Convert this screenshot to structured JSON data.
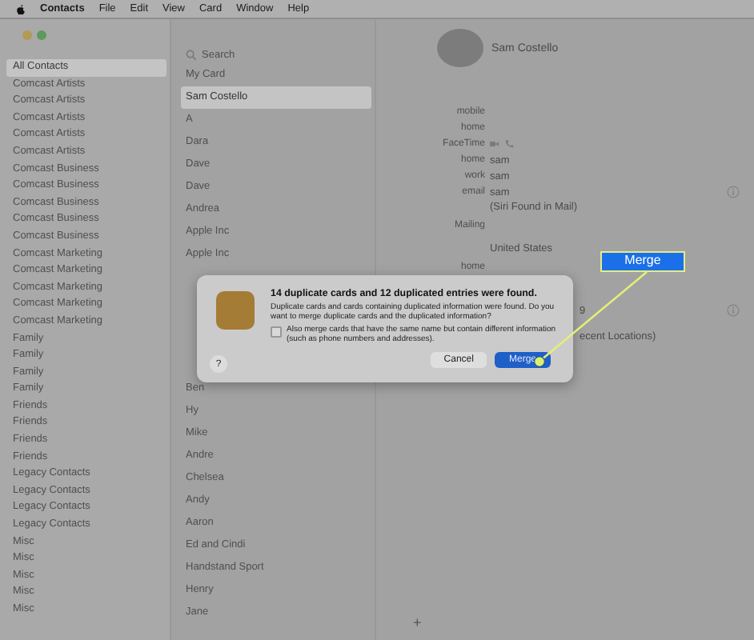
{
  "menu_bar": {
    "items": [
      {
        "label": "Contacts",
        "kind": "app"
      },
      {
        "label": "File",
        "kind": "menu"
      },
      {
        "label": "Edit",
        "kind": "menu"
      },
      {
        "label": "View",
        "kind": "menu"
      },
      {
        "label": "Card",
        "kind": "menu"
      },
      {
        "label": "Window",
        "kind": "menu"
      },
      {
        "label": "Help",
        "kind": "menu"
      }
    ]
  },
  "sidebar": {
    "items": [
      {
        "label": "All Contacts",
        "selected": true
      },
      {
        "label": "Comcast Artists",
        "selected": false
      },
      {
        "label": "Comcast Artists",
        "selected": false
      },
      {
        "label": "Comcast Artists",
        "selected": false
      },
      {
        "label": "Comcast Artists",
        "selected": false
      },
      {
        "label": "Comcast Artists",
        "selected": false
      },
      {
        "label": "Comcast Business",
        "selected": false
      },
      {
        "label": "Comcast Business",
        "selected": false
      },
      {
        "label": "Comcast Business",
        "selected": false
      },
      {
        "label": "Comcast Business",
        "selected": false
      },
      {
        "label": "Comcast Business",
        "selected": false
      },
      {
        "label": "Comcast Marketing",
        "selected": false
      },
      {
        "label": "Comcast Marketing",
        "selected": false
      },
      {
        "label": "Comcast Marketing",
        "selected": false
      },
      {
        "label": "Comcast Marketing",
        "selected": false
      },
      {
        "label": "Comcast Marketing",
        "selected": false
      },
      {
        "label": "Family",
        "selected": false
      },
      {
        "label": "Family",
        "selected": false
      },
      {
        "label": "Family",
        "selected": false
      },
      {
        "label": "Family",
        "selected": false
      },
      {
        "label": "Friends",
        "selected": false
      },
      {
        "label": "Friends",
        "selected": false
      },
      {
        "label": "Friends",
        "selected": false
      },
      {
        "label": "Friends",
        "selected": false
      },
      {
        "label": "Legacy Contacts",
        "selected": false
      },
      {
        "label": "Legacy Contacts",
        "selected": false
      },
      {
        "label": "Legacy Contacts",
        "selected": false
      },
      {
        "label": "Legacy Contacts",
        "selected": false
      },
      {
        "label": "Misc",
        "selected": false
      },
      {
        "label": "Misc",
        "selected": false
      },
      {
        "label": "Misc",
        "selected": false
      },
      {
        "label": "Misc",
        "selected": false
      },
      {
        "label": "Misc",
        "selected": false
      }
    ]
  },
  "contact_list": {
    "search": {
      "placeholder": "Search"
    },
    "items_top": [
      {
        "label": "My Card",
        "selected": false
      },
      {
        "label": "Sam Costello",
        "selected": true
      },
      {
        "label": "A",
        "selected": false
      },
      {
        "label": "Dara",
        "selected": false
      },
      {
        "label": "Dave",
        "selected": false
      },
      {
        "label": "Dave",
        "selected": false
      },
      {
        "label": "Andrea",
        "selected": false
      },
      {
        "label": "Apple Inc",
        "selected": false
      },
      {
        "label": "Apple Inc",
        "selected": false
      }
    ],
    "items_bottom": [
      {
        "label": "Ben",
        "selected": false
      },
      {
        "label": "Hy",
        "selected": false
      },
      {
        "label": "Mike",
        "selected": false
      },
      {
        "label": "Andre",
        "selected": false
      },
      {
        "label": "Chelsea",
        "selected": false
      },
      {
        "label": "Andy",
        "selected": false
      },
      {
        "label": "Aaron",
        "selected": false
      },
      {
        "label": "Ed and Cindi",
        "selected": false
      },
      {
        "label": "Handstand Sport",
        "selected": false
      },
      {
        "label": "Henry",
        "selected": false
      },
      {
        "label": "Jane",
        "selected": false
      }
    ]
  },
  "card": {
    "name": "Sam Costello",
    "fields": [
      {
        "kind": "field",
        "label": "mobile"
      },
      {
        "kind": "field",
        "label": "home"
      },
      {
        "kind": "facetime",
        "label": "FaceTime"
      },
      {
        "kind": "field",
        "label": "home",
        "value": "sam"
      },
      {
        "kind": "field",
        "label": "work",
        "value": "sam"
      },
      {
        "kind": "field",
        "label": "email",
        "value": "sam",
        "info": true
      },
      {
        "kind": "note",
        "value": "(Siri Found in Mail)"
      },
      {
        "kind": "section",
        "label": "Mailing"
      },
      {
        "kind": "address",
        "value": "United States"
      },
      {
        "kind": "field",
        "label": "home"
      },
      {
        "kind": "partial",
        "value": "9",
        "info": true
      },
      {
        "kind": "partial",
        "value": "ecent Locations)"
      }
    ]
  },
  "dialog": {
    "title": "14 duplicate cards and 12 duplicated entries were found.",
    "message": "Duplicate cards and cards containing duplicated information were found. Do you want to merge duplicate cards and the duplicated information?",
    "checkbox": {
      "label": "Also merge cards that have the same name but contain different information (such as phone numbers and addresses).",
      "checked": false
    },
    "help": "?",
    "buttons": [
      {
        "label": "Cancel",
        "kind": "secondary"
      },
      {
        "label": "Merge",
        "kind": "primary"
      }
    ]
  },
  "callout": {
    "label": "Merge"
  },
  "bottom_bar": {
    "add": "+"
  }
}
